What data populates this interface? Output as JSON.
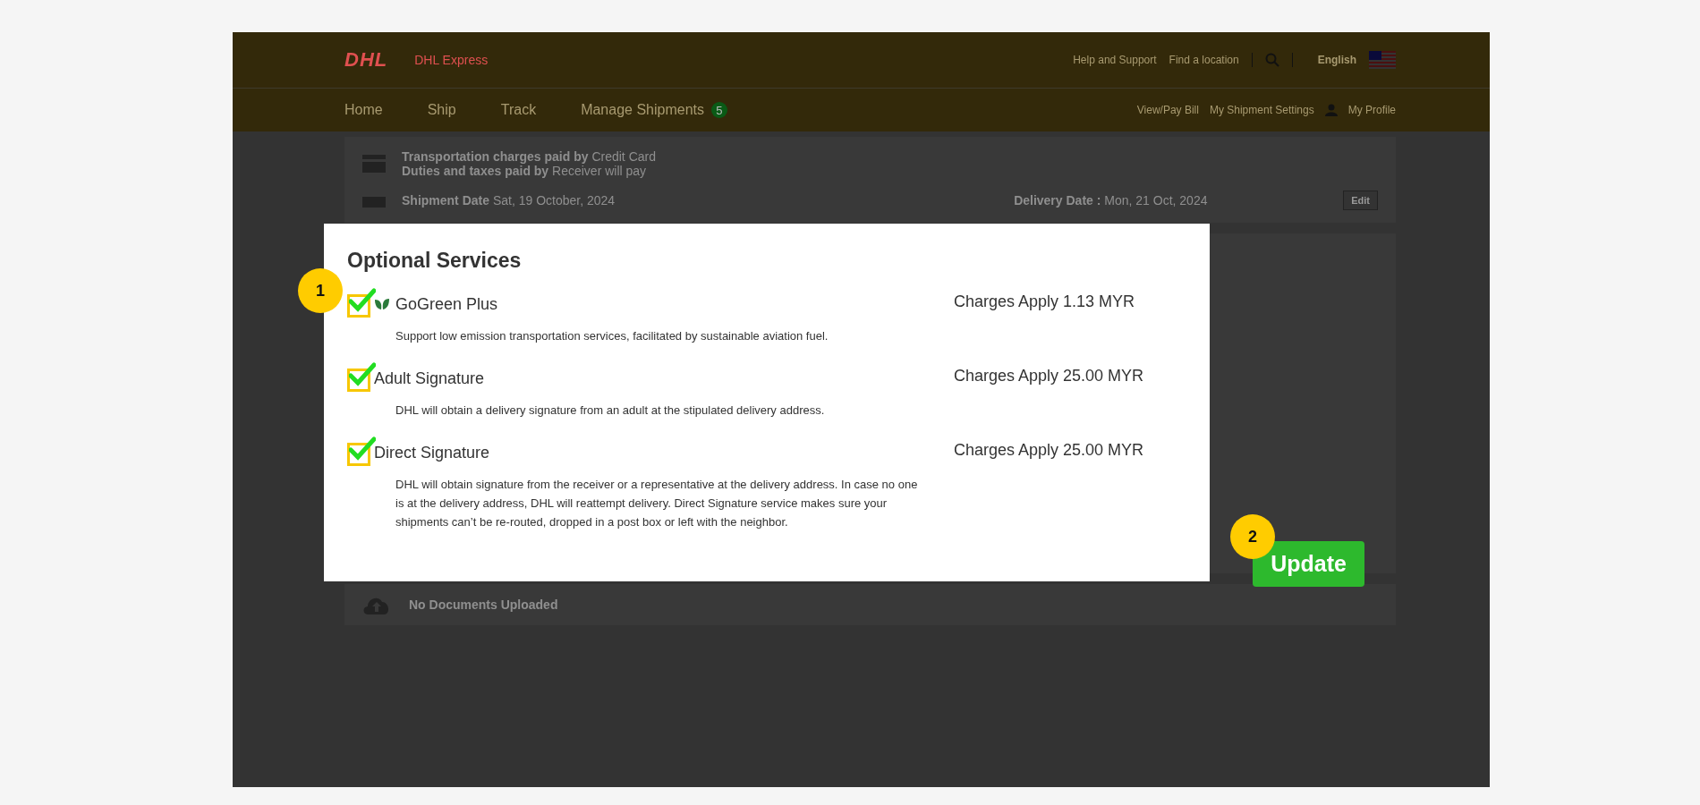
{
  "header": {
    "logo": "DHL",
    "brand": "DHL Express",
    "links": [
      "Help and Support",
      "Find a location"
    ],
    "language": "English"
  },
  "nav": {
    "items": [
      {
        "label": "Home"
      },
      {
        "label": "Ship"
      },
      {
        "label": "Track"
      },
      {
        "label": "Manage Shipments",
        "badge": "5"
      }
    ],
    "right_links": [
      "View/Pay Bill",
      "My Shipment Settings",
      "My Profile"
    ]
  },
  "payment": [
    {
      "label": "Transportation charges paid by",
      "value": "Credit Card"
    },
    {
      "label": "Duties and taxes paid by",
      "value": "Receiver will pay"
    }
  ],
  "dates": {
    "shipment_label": "Shipment Date",
    "shipment_value": "Sat, 19 October, 2024",
    "delivery_label": "Delivery Date :",
    "delivery_value": "Mon, 21 Oct, 2024",
    "edit_button": "Edit"
  },
  "documents": "No Documents Uploaded",
  "modal": {
    "title": "Optional Services",
    "services": [
      {
        "kind": "green",
        "name": "GoGreen Plus",
        "charge": "Charges Apply 1.13 MYR",
        "description": "Support low emission transportation services, facilitated by sustainable aviation fuel.",
        "checked": true
      },
      {
        "kind": "standard",
        "name": "Adult Signature",
        "charge": "Charges Apply 25.00 MYR",
        "description": "DHL will obtain a delivery signature from an adult at the stipulated delivery address.",
        "checked": true
      },
      {
        "kind": "standard",
        "name": "Direct Signature",
        "charge": "Charges Apply 25.00 MYR",
        "description": "DHL will obtain signature from the receiver or a representative at the delivery address. In case no one is at the delivery address, DHL will reattempt delivery. Direct Signature service makes sure your shipments can’t be re-routed, dropped in a post box or left with the neighbor.",
        "checked": true
      }
    ]
  },
  "update_button": "Update",
  "callouts": [
    "1",
    "2"
  ]
}
